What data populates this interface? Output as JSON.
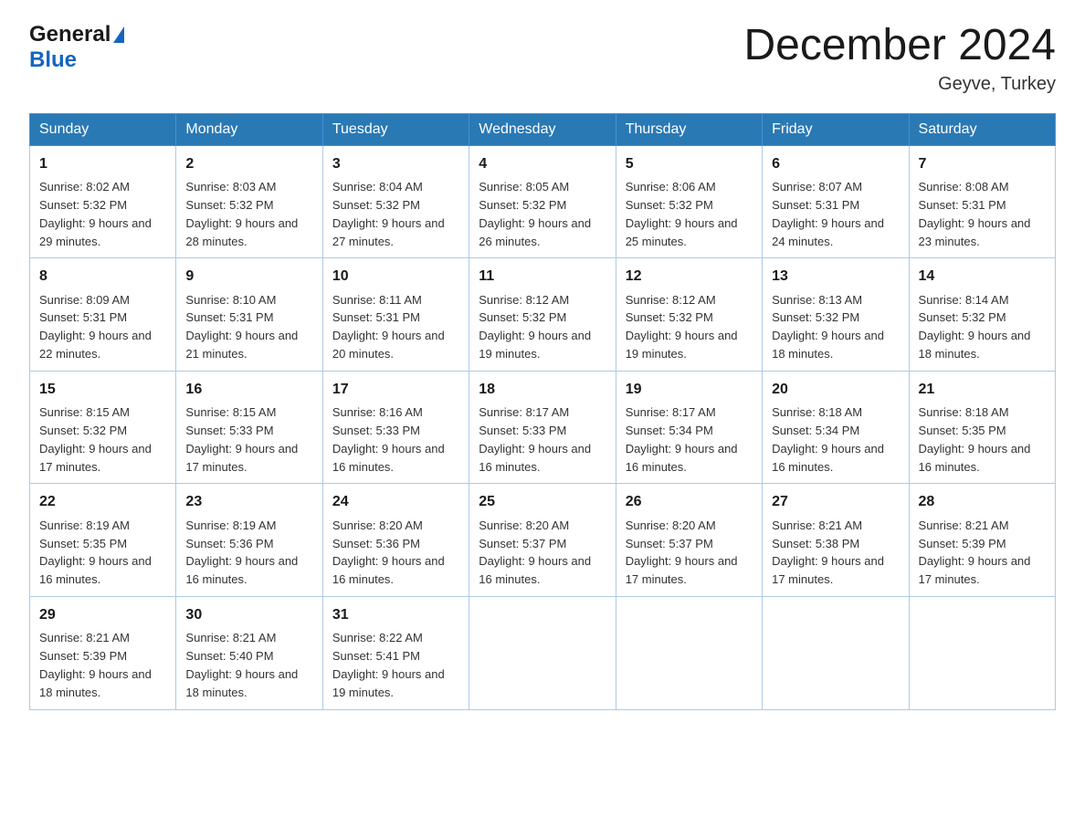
{
  "logo": {
    "line1": "General",
    "triangle": "▶",
    "line2": "Blue"
  },
  "title": "December 2024",
  "subtitle": "Geyve, Turkey",
  "days": [
    "Sunday",
    "Monday",
    "Tuesday",
    "Wednesday",
    "Thursday",
    "Friday",
    "Saturday"
  ],
  "weeks": [
    [
      {
        "num": "1",
        "sunrise": "8:02 AM",
        "sunset": "5:32 PM",
        "daylight": "9 hours and 29 minutes."
      },
      {
        "num": "2",
        "sunrise": "8:03 AM",
        "sunset": "5:32 PM",
        "daylight": "9 hours and 28 minutes."
      },
      {
        "num": "3",
        "sunrise": "8:04 AM",
        "sunset": "5:32 PM",
        "daylight": "9 hours and 27 minutes."
      },
      {
        "num": "4",
        "sunrise": "8:05 AM",
        "sunset": "5:32 PM",
        "daylight": "9 hours and 26 minutes."
      },
      {
        "num": "5",
        "sunrise": "8:06 AM",
        "sunset": "5:32 PM",
        "daylight": "9 hours and 25 minutes."
      },
      {
        "num": "6",
        "sunrise": "8:07 AM",
        "sunset": "5:31 PM",
        "daylight": "9 hours and 24 minutes."
      },
      {
        "num": "7",
        "sunrise": "8:08 AM",
        "sunset": "5:31 PM",
        "daylight": "9 hours and 23 minutes."
      }
    ],
    [
      {
        "num": "8",
        "sunrise": "8:09 AM",
        "sunset": "5:31 PM",
        "daylight": "9 hours and 22 minutes."
      },
      {
        "num": "9",
        "sunrise": "8:10 AM",
        "sunset": "5:31 PM",
        "daylight": "9 hours and 21 minutes."
      },
      {
        "num": "10",
        "sunrise": "8:11 AM",
        "sunset": "5:31 PM",
        "daylight": "9 hours and 20 minutes."
      },
      {
        "num": "11",
        "sunrise": "8:12 AM",
        "sunset": "5:32 PM",
        "daylight": "9 hours and 19 minutes."
      },
      {
        "num": "12",
        "sunrise": "8:12 AM",
        "sunset": "5:32 PM",
        "daylight": "9 hours and 19 minutes."
      },
      {
        "num": "13",
        "sunrise": "8:13 AM",
        "sunset": "5:32 PM",
        "daylight": "9 hours and 18 minutes."
      },
      {
        "num": "14",
        "sunrise": "8:14 AM",
        "sunset": "5:32 PM",
        "daylight": "9 hours and 18 minutes."
      }
    ],
    [
      {
        "num": "15",
        "sunrise": "8:15 AM",
        "sunset": "5:32 PM",
        "daylight": "9 hours and 17 minutes."
      },
      {
        "num": "16",
        "sunrise": "8:15 AM",
        "sunset": "5:33 PM",
        "daylight": "9 hours and 17 minutes."
      },
      {
        "num": "17",
        "sunrise": "8:16 AM",
        "sunset": "5:33 PM",
        "daylight": "9 hours and 16 minutes."
      },
      {
        "num": "18",
        "sunrise": "8:17 AM",
        "sunset": "5:33 PM",
        "daylight": "9 hours and 16 minutes."
      },
      {
        "num": "19",
        "sunrise": "8:17 AM",
        "sunset": "5:34 PM",
        "daylight": "9 hours and 16 minutes."
      },
      {
        "num": "20",
        "sunrise": "8:18 AM",
        "sunset": "5:34 PM",
        "daylight": "9 hours and 16 minutes."
      },
      {
        "num": "21",
        "sunrise": "8:18 AM",
        "sunset": "5:35 PM",
        "daylight": "9 hours and 16 minutes."
      }
    ],
    [
      {
        "num": "22",
        "sunrise": "8:19 AM",
        "sunset": "5:35 PM",
        "daylight": "9 hours and 16 minutes."
      },
      {
        "num": "23",
        "sunrise": "8:19 AM",
        "sunset": "5:36 PM",
        "daylight": "9 hours and 16 minutes."
      },
      {
        "num": "24",
        "sunrise": "8:20 AM",
        "sunset": "5:36 PM",
        "daylight": "9 hours and 16 minutes."
      },
      {
        "num": "25",
        "sunrise": "8:20 AM",
        "sunset": "5:37 PM",
        "daylight": "9 hours and 16 minutes."
      },
      {
        "num": "26",
        "sunrise": "8:20 AM",
        "sunset": "5:37 PM",
        "daylight": "9 hours and 17 minutes."
      },
      {
        "num": "27",
        "sunrise": "8:21 AM",
        "sunset": "5:38 PM",
        "daylight": "9 hours and 17 minutes."
      },
      {
        "num": "28",
        "sunrise": "8:21 AM",
        "sunset": "5:39 PM",
        "daylight": "9 hours and 17 minutes."
      }
    ],
    [
      {
        "num": "29",
        "sunrise": "8:21 AM",
        "sunset": "5:39 PM",
        "daylight": "9 hours and 18 minutes."
      },
      {
        "num": "30",
        "sunrise": "8:21 AM",
        "sunset": "5:40 PM",
        "daylight": "9 hours and 18 minutes."
      },
      {
        "num": "31",
        "sunrise": "8:22 AM",
        "sunset": "5:41 PM",
        "daylight": "9 hours and 19 minutes."
      },
      null,
      null,
      null,
      null
    ]
  ]
}
